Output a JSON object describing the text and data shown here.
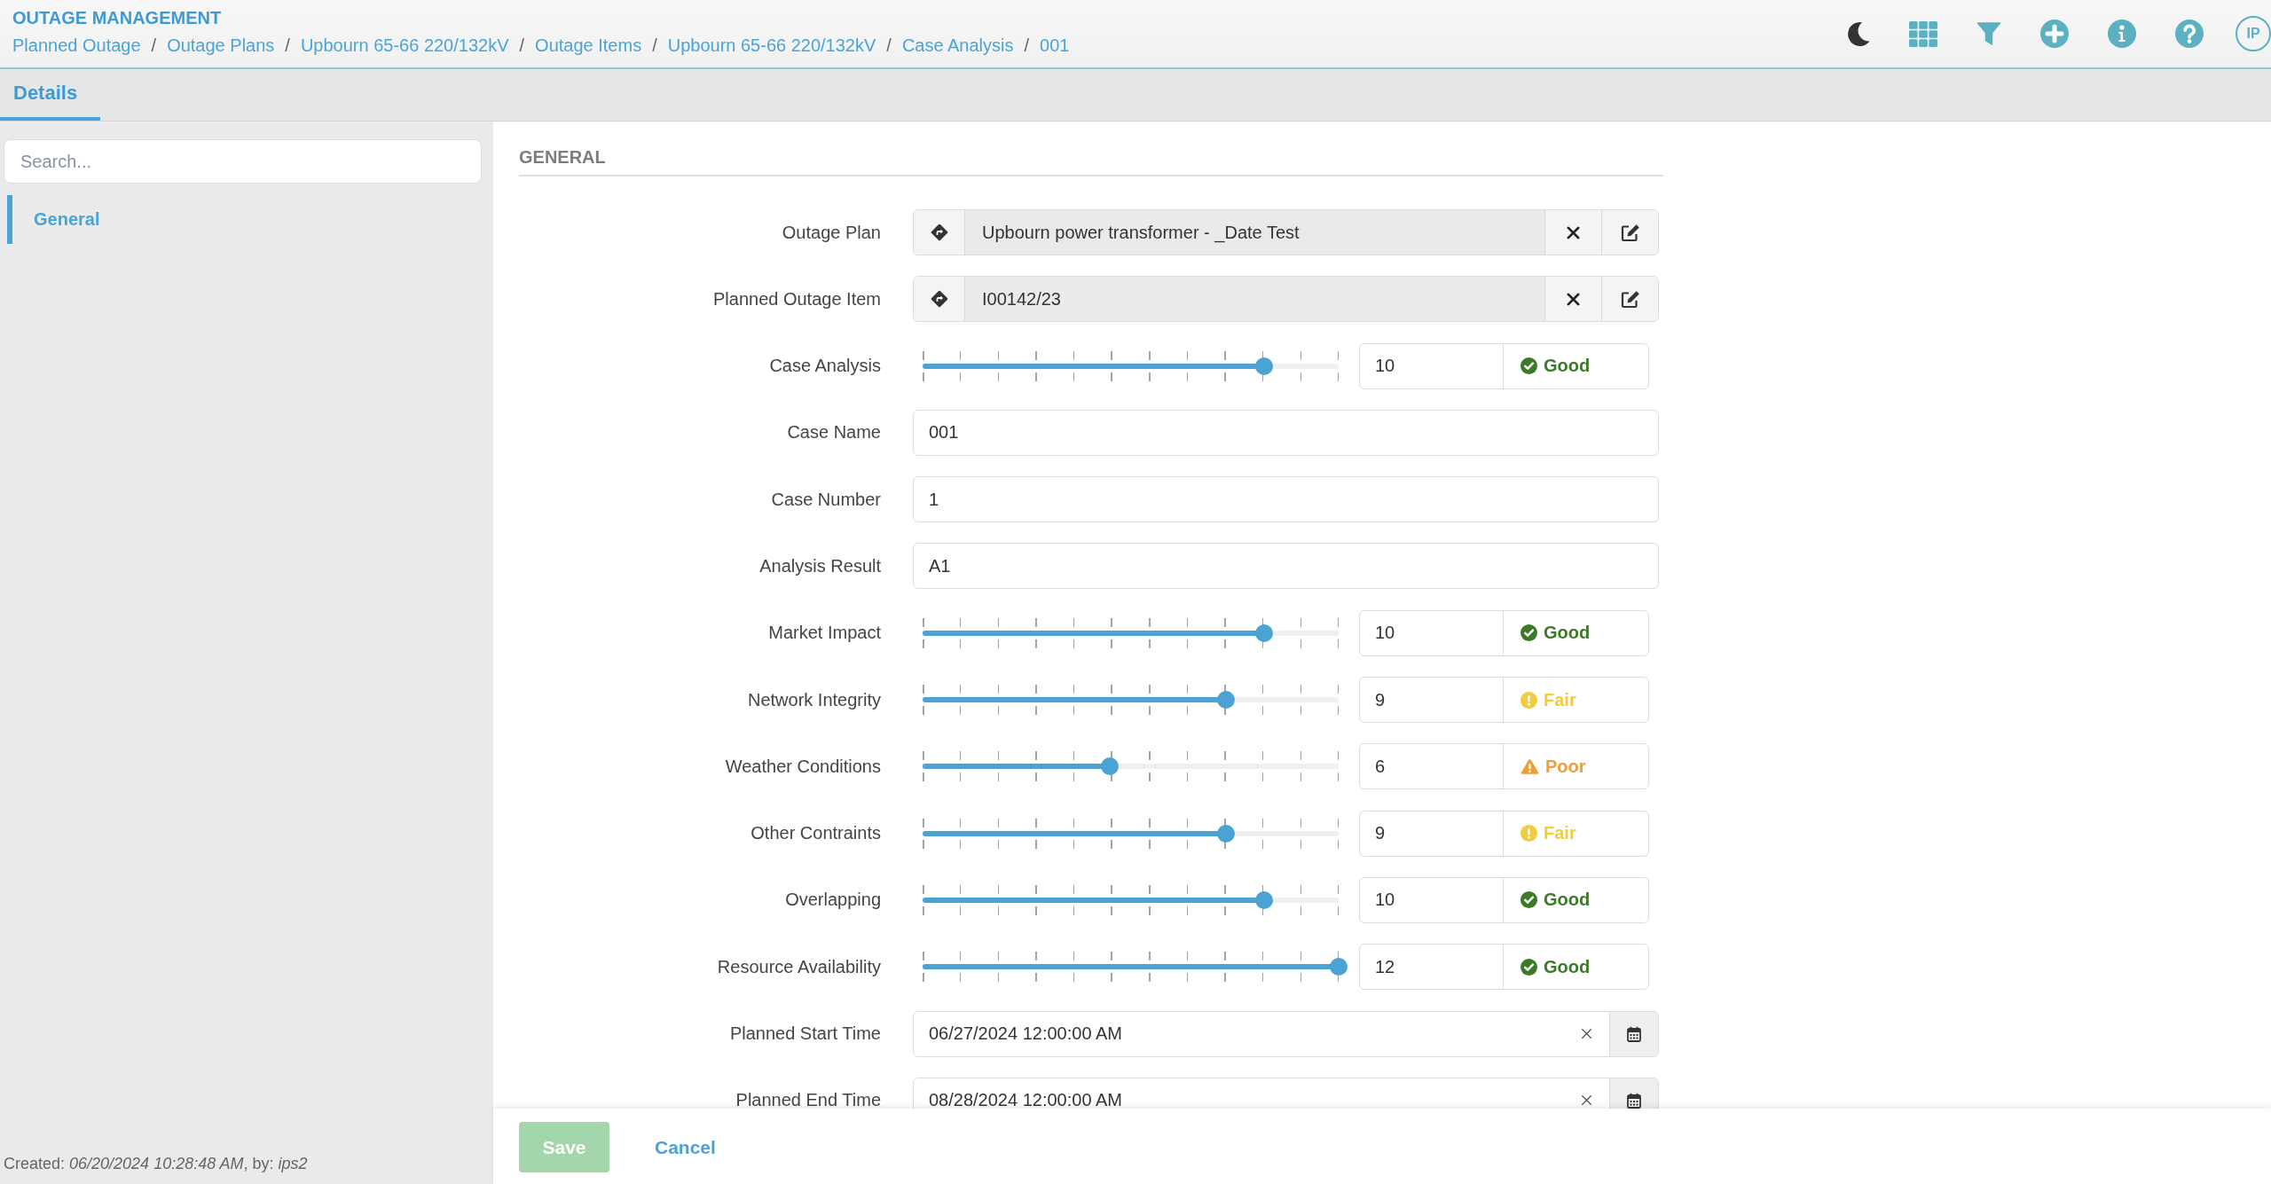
{
  "header": {
    "app_title": "OUTAGE MANAGEMENT",
    "breadcrumbs": [
      {
        "label": "Planned Outage",
        "separator": "/"
      },
      {
        "label": "Outage Plans",
        "separator": "/"
      },
      {
        "label": "Upbourn 65-66 220/132kV",
        "separator": "/"
      },
      {
        "label": "Outage Items",
        "separator": "/"
      },
      {
        "label": "Upbourn 65-66 220/132kV",
        "separator": "/"
      },
      {
        "label": "Case Analysis",
        "separator": "/"
      },
      {
        "label": "001"
      }
    ],
    "user_initials": "IP"
  },
  "tabs": [
    {
      "label": "Details",
      "selected": true
    }
  ],
  "sidebar": {
    "search": {
      "placeholder": "Search..."
    },
    "items": [
      {
        "label": "General",
        "selected": true
      }
    ],
    "created_note": "Created: *06/20/2024 10:28:48 AM*, by: *ips2*"
  },
  "section": {
    "title": "GENERAL",
    "fields": [
      {
        "kind": "lookup",
        "label": "Outage Plan",
        "value": "Upbourn power transformer - _Date Test"
      },
      {
        "kind": "lookup",
        "label": "Planned Outage Item",
        "value": "I00142/23"
      },
      {
        "kind": "rating",
        "label": "Case Analysis",
        "level": 0.82,
        "value": "10",
        "status": {
          "kind": "good",
          "label": "Good"
        }
      },
      {
        "kind": "text",
        "label": "Case Name",
        "value": "001"
      },
      {
        "kind": "text",
        "label": "Case Number",
        "value": "1"
      },
      {
        "kind": "text",
        "label": "Analysis Result",
        "value": "A1"
      },
      {
        "kind": "rating",
        "label": "Market Impact",
        "level": 0.82,
        "value": "10",
        "status": {
          "kind": "good",
          "label": "Good"
        }
      },
      {
        "kind": "rating",
        "label": "Network Integrity",
        "level": 0.73,
        "value": "9",
        "status": {
          "kind": "fair",
          "label": "Fair"
        }
      },
      {
        "kind": "rating",
        "label": "Weather Conditions",
        "level": 0.45,
        "value": "6",
        "status": {
          "kind": "poor",
          "label": "Poor"
        }
      },
      {
        "kind": "rating",
        "label": "Other Contraints",
        "level": 0.73,
        "value": "9",
        "status": {
          "kind": "fair",
          "label": "Fair"
        }
      },
      {
        "kind": "rating",
        "label": "Overlapping",
        "level": 0.82,
        "value": "10",
        "status": {
          "kind": "good",
          "label": "Good"
        }
      },
      {
        "kind": "rating",
        "label": "Resource Availability",
        "level": 1,
        "value": "12",
        "status": {
          "kind": "good",
          "label": "Good"
        }
      },
      {
        "kind": "date",
        "label": "Planned Start Time",
        "value": "06/27/2024 12:00:00 AM"
      },
      {
        "kind": "date",
        "label": "Planned End Time",
        "value": "08/28/2024 12:00:00 AM"
      }
    ]
  },
  "footer": {
    "buttons": [
      {
        "kind": "primary",
        "label": "Save",
        "disabled": true
      },
      {
        "kind": "link",
        "label": "Cancel"
      }
    ]
  }
}
